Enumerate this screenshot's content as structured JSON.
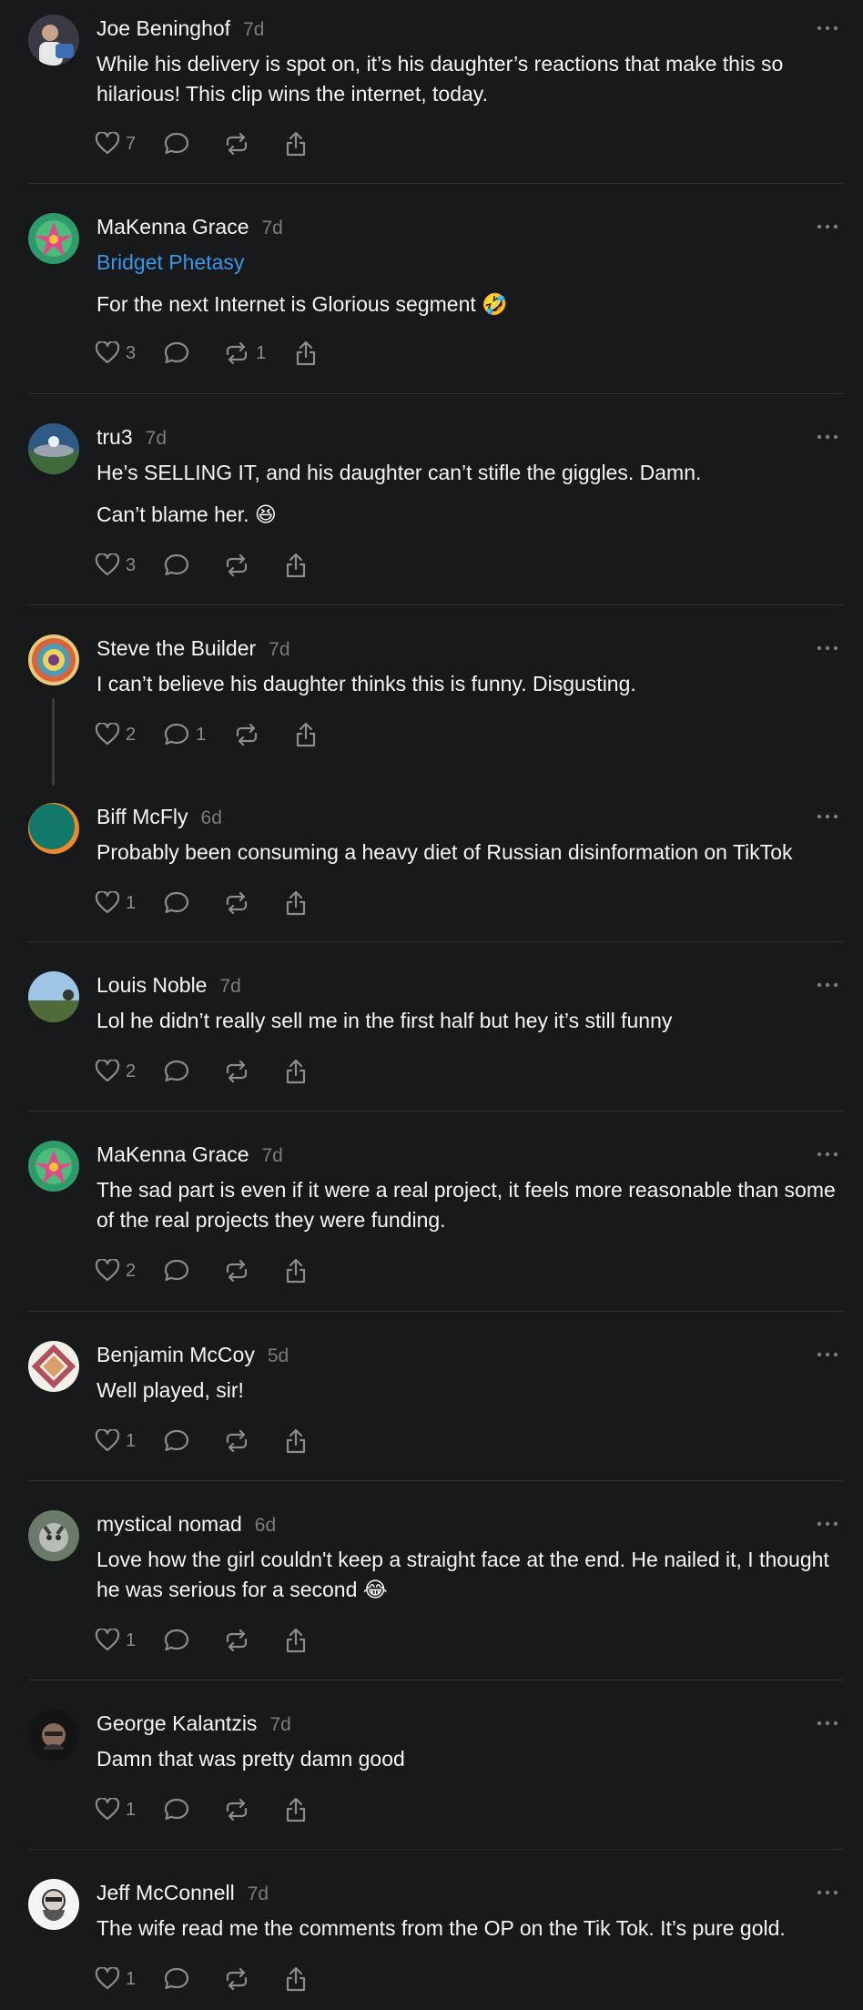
{
  "posts": [
    {
      "name": "Joe Beninghof",
      "time": "7d",
      "tag": "",
      "text": [
        "While his delivery is spot on, it’s his daughter’s reactions that make this so hilarious! This clip wins the internet, today."
      ],
      "likes": "7",
      "replies": "",
      "reposts": ""
    },
    {
      "name": "MaKenna Grace",
      "time": "7d",
      "tag": "Bridget Phetasy",
      "text": [
        "For the next Internet is Glorious segment 🤣"
      ],
      "likes": "3",
      "replies": "",
      "reposts": "1"
    },
    {
      "name": "tru3",
      "time": "7d",
      "tag": "",
      "text": [
        "He’s SELLING IT, and his daughter can’t stifle the giggles. Damn.",
        "Can’t blame her. 😆"
      ],
      "likes": "3",
      "replies": "",
      "reposts": ""
    },
    {
      "name": "Steve the Builder",
      "time": "7d",
      "tag": "",
      "text": [
        "I can’t believe his daughter thinks this is funny. Disgusting."
      ],
      "likes": "2",
      "replies": "1",
      "reposts": ""
    },
    {
      "name": "Biff McFly",
      "time": "6d",
      "tag": "",
      "text": [
        "Probably been consuming a heavy diet of Russian disinformation on TikTok"
      ],
      "likes": "1",
      "replies": "",
      "reposts": ""
    },
    {
      "name": "Louis Noble",
      "time": "7d",
      "tag": "",
      "text": [
        "Lol he didn’t really sell me in the first half but hey it’s still funny"
      ],
      "likes": "2",
      "replies": "",
      "reposts": ""
    },
    {
      "name": "MaKenna Grace",
      "time": "7d",
      "tag": "",
      "text": [
        "The sad part is even if it were a real project, it feels more reasonable than some of the real projects they were funding."
      ],
      "likes": "2",
      "replies": "",
      "reposts": ""
    },
    {
      "name": "Benjamin McCoy",
      "time": "5d",
      "tag": "",
      "text": [
        "Well played, sir!"
      ],
      "likes": "1",
      "replies": "",
      "reposts": ""
    },
    {
      "name": "mystical nomad",
      "time": "6d",
      "tag": "",
      "text": [
        "Love how the girl couldn't keep a straight face at the end. He nailed it, I thought he was serious for a second 😂"
      ],
      "likes": "1",
      "replies": "",
      "reposts": ""
    },
    {
      "name": "George Kalantzis",
      "time": "7d",
      "tag": "",
      "text": [
        "Damn that was pretty damn good"
      ],
      "likes": "1",
      "replies": "",
      "reposts": ""
    },
    {
      "name": "Jeff McConnell",
      "time": "7d",
      "tag": "",
      "text": [
        "The wife read me the comments from the OP on the Tik Tok. It’s pure gold."
      ],
      "likes": "1",
      "replies": "",
      "reposts": ""
    }
  ],
  "icons": {
    "like": "heart-icon",
    "reply": "comment-icon",
    "repost": "repost-icon",
    "share": "share-icon",
    "more": "more-icon"
  },
  "colors": {
    "background": "#18191b",
    "text": "#f3f5f7",
    "muted": "#7a7c80",
    "link": "#3a97e8",
    "divider": "#2e3033"
  }
}
